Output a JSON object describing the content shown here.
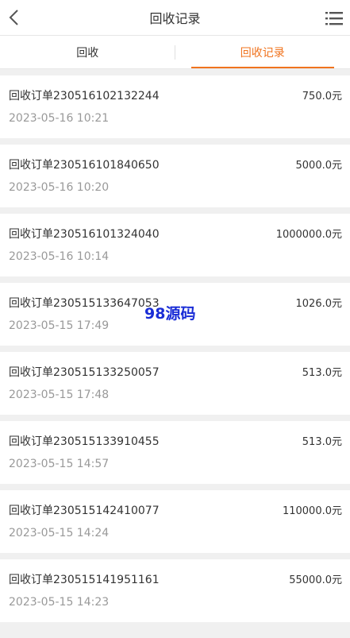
{
  "header": {
    "title": "回收记录",
    "back_icon": "chevron-left-icon",
    "menu_icon": "list-menu-icon"
  },
  "tabs": [
    {
      "label": "回收",
      "active": false
    },
    {
      "label": "回收记录",
      "active": true
    }
  ],
  "accent_color": "#f0731e",
  "records": [
    {
      "order": "回收订单230516102132244",
      "amount": "750.0元",
      "time": "2023-05-16 10:21"
    },
    {
      "order": "回收订单230516101840650",
      "amount": "5000.0元",
      "time": "2023-05-16 10:20"
    },
    {
      "order": "回收订单230516101324040",
      "amount": "1000000.0元",
      "time": "2023-05-16 10:14"
    },
    {
      "order": "回收订单230515133647053",
      "amount": "1026.0元",
      "time": "2023-05-15 17:49"
    },
    {
      "order": "回收订单230515133250057",
      "amount": "513.0元",
      "time": "2023-05-15 17:48"
    },
    {
      "order": "回收订单230515133910455",
      "amount": "513.0元",
      "time": "2023-05-15 14:57"
    },
    {
      "order": "回收订单230515142410077",
      "amount": "110000.0元",
      "time": "2023-05-15 14:24"
    },
    {
      "order": "回收订单230515141951161",
      "amount": "55000.0元",
      "time": "2023-05-15 14:23"
    }
  ],
  "watermark": "98源码"
}
